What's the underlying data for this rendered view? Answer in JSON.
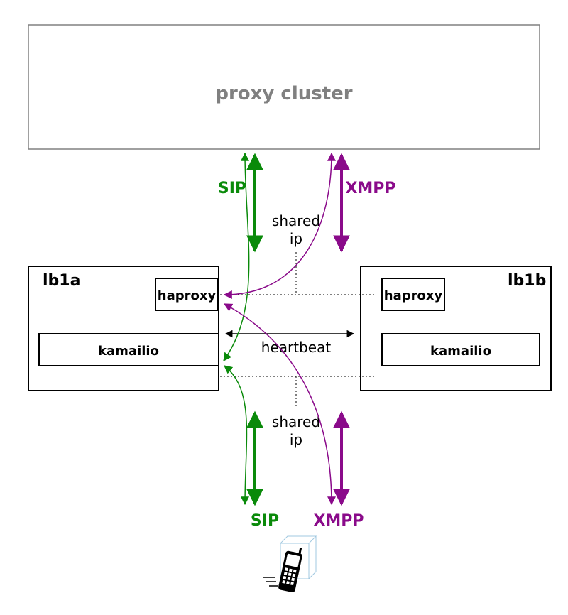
{
  "title": "proxy cluster",
  "nodes": {
    "left": {
      "name": "lb1a",
      "haproxy": "haproxy",
      "kamailio": "kamailio"
    },
    "right": {
      "name": "lb1b",
      "haproxy": "haproxy",
      "kamailio": "kamailio"
    }
  },
  "labels": {
    "sip_top": "SIP",
    "xmpp_top": "XMPP",
    "sip_bottom": "SIP",
    "xmpp_bottom": "XMPP",
    "shared_ip_top_1": "shared",
    "shared_ip_top_2": "ip",
    "shared_ip_bottom_1": "shared",
    "shared_ip_bottom_2": "ip",
    "heartbeat": "heartbeat"
  },
  "colors": {
    "sip": "#0a8a0a",
    "xmpp": "#8a0a8a",
    "border": "#808080"
  }
}
